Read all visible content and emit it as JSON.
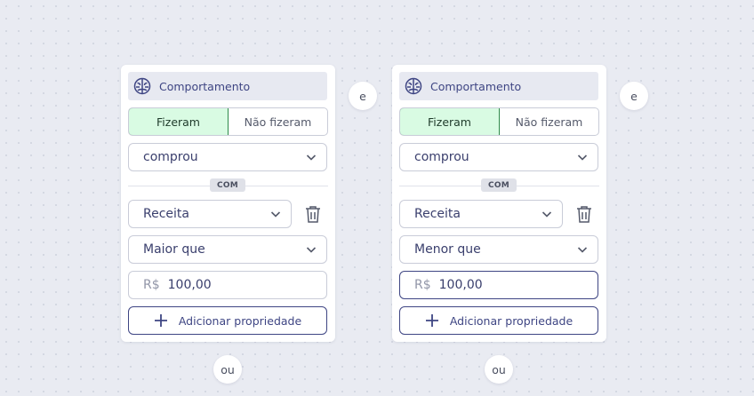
{
  "groups": [
    {
      "header": {
        "title": "Comportamento"
      },
      "segment": {
        "did": "Fizeram",
        "did_not": "Não fizeram"
      },
      "event": {
        "value": "comprou"
      },
      "with_badge": "COM",
      "property": {
        "value": "Receita"
      },
      "operator": {
        "value": "Maior que"
      },
      "amount": {
        "currency": "R$",
        "value": "100,00"
      },
      "add_property_label": "Adicionar propriedade",
      "and_label": "e"
    },
    {
      "header": {
        "title": "Comportamento"
      },
      "segment": {
        "did": "Fizeram",
        "did_not": "Não fizeram"
      },
      "event": {
        "value": "comprou"
      },
      "with_badge": "COM",
      "property": {
        "value": "Receita"
      },
      "operator": {
        "value": "Menor que"
      },
      "amount": {
        "currency": "R$",
        "value": "100,00"
      },
      "add_property_label": "Adicionar propriedade",
      "and_label": "e"
    }
  ],
  "or_connectors": [
    "ou",
    "ou"
  ],
  "colors": {
    "accent": "#3e4583",
    "active_segment_bg": "#d9fbe3",
    "active_segment_border": "#2f8a4a"
  }
}
